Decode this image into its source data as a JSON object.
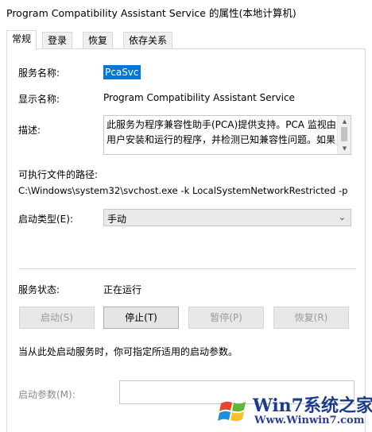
{
  "window": {
    "title": "Program Compatibility Assistant Service 的属性(本地计算机)"
  },
  "tabs": [
    {
      "label": "常规",
      "active": true
    },
    {
      "label": "登录",
      "active": false
    },
    {
      "label": "恢复",
      "active": false
    },
    {
      "label": "依存关系",
      "active": false
    }
  ],
  "general": {
    "service_name_label": "服务名称:",
    "service_name_value": "PcaSvc",
    "display_name_label": "显示名称:",
    "display_name_value": "Program Compatibility Assistant Service",
    "description_label": "描述:",
    "description_value": "此服务为程序兼容性助手(PCA)提供支持。PCA 监视由用户安装和运行的程序，并检测已知兼容性问题。如果",
    "exe_path_label": "可执行文件的路径:",
    "exe_path_value": "C:\\Windows\\system32\\svchost.exe -k LocalSystemNetworkRestricted -p",
    "startup_type_label": "启动类型(E):",
    "startup_type_value": "手动",
    "status_label": "服务状态:",
    "status_value": "正在运行",
    "buttons": {
      "start": "启动(S)",
      "stop": "停止(T)",
      "pause": "暂停(P)",
      "resume": "恢复(R)"
    },
    "hint_text": "当从此处启动服务时，你可指定所适用的启动参数。",
    "start_params_label": "启动参数(M):",
    "start_params_value": ""
  },
  "watermark": {
    "line1": "Win7系统之家",
    "line2": "Www.Winwin7.com"
  },
  "colors": {
    "selection": "#0078d7",
    "watermark_blue": "#1c3b8c"
  }
}
